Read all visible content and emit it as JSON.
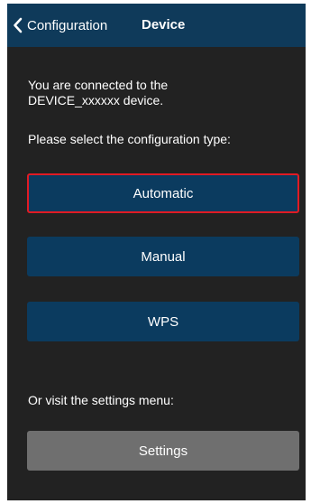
{
  "navbar": {
    "back_label": "Configuration",
    "title": "Device"
  },
  "intro": {
    "line1": "You are connected to the",
    "line2": "DEVICE_xxxxxx device."
  },
  "select_prompt": "Please select the configuration type:",
  "config_buttons": [
    {
      "label": "Automatic",
      "highlighted": true
    },
    {
      "label": "Manual"
    },
    {
      "label": "WPS"
    }
  ],
  "settings_prompt": "Or visit the settings menu:",
  "settings_button": {
    "label": "Settings"
  },
  "colors": {
    "navbar": "#0f3a5a",
    "background": "#222222",
    "button_blue": "#0b3b5f",
    "button_gray": "#6f6f6f",
    "highlight": "#e01b24"
  },
  "icons": {
    "back": "chevron-left-icon"
  }
}
